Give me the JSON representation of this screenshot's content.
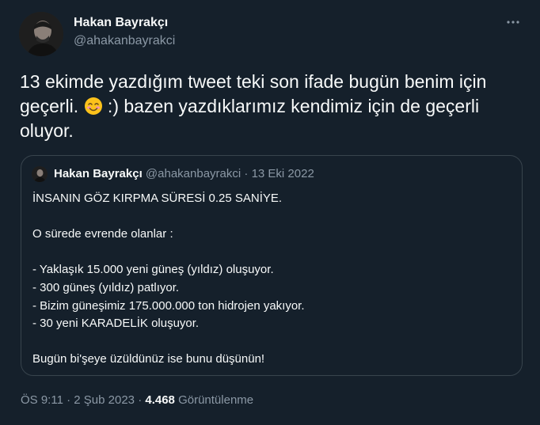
{
  "author": {
    "name": "Hakan Bayrakçı",
    "handle": "@ahakanbayrakci"
  },
  "more_icon": "more-horizontal-icon",
  "tweet": {
    "text_before_emoji": "13 ekimde yazdığım tweet teki son ifade bugün benim için geçerli. ",
    "emoji": "smiling-face-with-smiling-eyes-emoji",
    "text_after_emoji": " :) bazen yazdıklarımız kendimiz için de geçerli oluyor."
  },
  "quoted_tweet": {
    "name": "Hakan Bayrakçı",
    "handle": "@ahakanbayrakci",
    "separator": "·",
    "date": "13 Eki 2022",
    "lines": [
      "İNSANIN GÖZ KIRPMA SÜRESİ 0.25 SANİYE.",
      "",
      "O sürede evrende olanlar :",
      "",
      "- Yaklaşık 15.000 yeni güneş (yıldız) oluşuyor.",
      "- 300 güneş (yıldız) patlıyor.",
      "- Bizim güneşimiz 175.000.000 ton hidrojen yakıyor.",
      "- 30 yeni KARADELİK oluşuyor.",
      "",
      "Bugün bi'şeye üzüldünüz ise bunu düşünün!"
    ]
  },
  "footer": {
    "time": "ÖS 9:11",
    "separator": "·",
    "date": "2 Şub 2023",
    "separator2": "·",
    "views_count": "4.468",
    "views_label": "Görüntülenme"
  },
  "colors": {
    "background": "#15202b",
    "text": "#f7f9f9",
    "secondary": "#8b98a5",
    "border": "#38444d"
  }
}
